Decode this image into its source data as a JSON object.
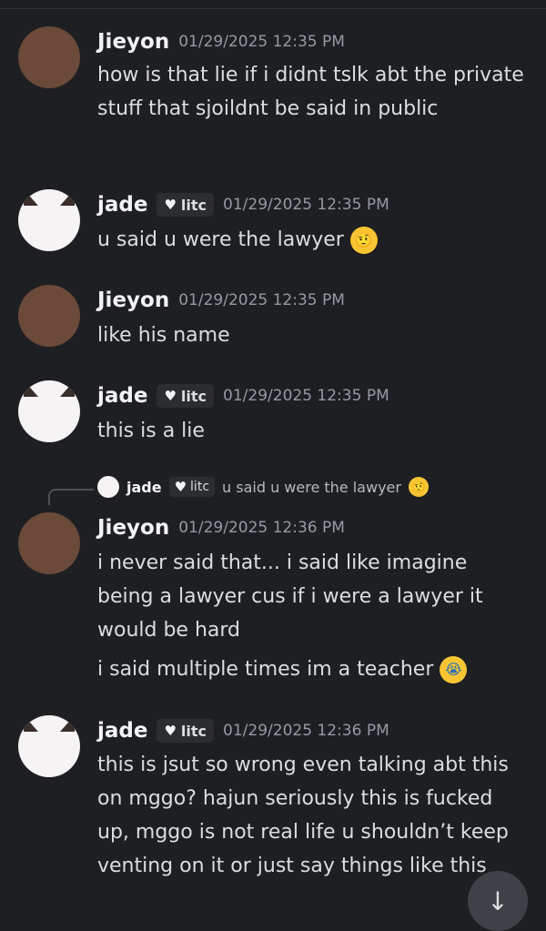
{
  "messages": [
    {
      "author": "Jieyon",
      "timestamp": "01/29/2025 12:35 PM",
      "text": "how is that lie if i didnt tslk abt the private stuff that sjoildnt be said in public"
    },
    {
      "author": "jade",
      "tag": "litc",
      "timestamp": "01/29/2025 12:35 PM",
      "text": "u said u were the lawyer",
      "emoji": "🤨"
    },
    {
      "author": "Jieyon",
      "timestamp": "01/29/2025 12:35 PM",
      "text": "like his name"
    },
    {
      "author": "jade",
      "tag": "litc",
      "timestamp": "01/29/2025 12:35 PM",
      "text": "this is a lie"
    },
    {
      "author": "Jieyon",
      "timestamp": "01/29/2025 12:36 PM",
      "reply": {
        "author": "jade",
        "tag": "litc",
        "text": "u said u were the lawyer",
        "emoji": "🤨"
      },
      "text": "i never said that... i said like imagine being a lawyer cus if i were a lawyer it would be hard",
      "text2": "i said multiple times im a teacher",
      "emoji": "😭"
    },
    {
      "author": "jade",
      "tag": "litc",
      "timestamp": "01/29/2025 12:36 PM",
      "text": "this is jsut so wrong even talking abt this on mggo? hajun seriously this is fucked up, mggo is not real life u shouldn’t keep venting on it or just say things like this"
    }
  ],
  "icons": {
    "heart": "heart-icon",
    "scroll_down": "arrow-down-icon"
  },
  "colors": {
    "background": "#1e1f22",
    "name": "#f2f3f5",
    "timestamp": "#949ba4",
    "text": "#dbdee1"
  }
}
